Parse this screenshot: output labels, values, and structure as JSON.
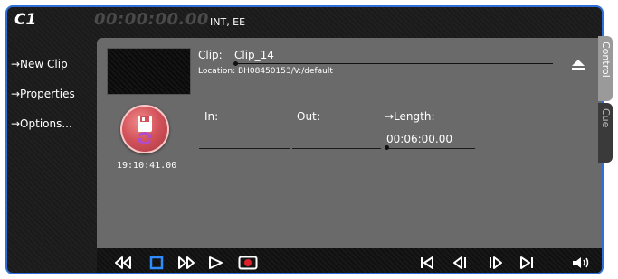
{
  "header": {
    "channel": "C1",
    "timecode": "00:00:00.00",
    "mode": "INT, EE"
  },
  "sidebar": {
    "items": [
      {
        "label": "→New Clip"
      },
      {
        "label": "→Properties"
      },
      {
        "label": "→Options..."
      }
    ]
  },
  "clip": {
    "label": "Clip:",
    "name": "Clip_14",
    "location": "Location: BH08450153/V:/default"
  },
  "record": {
    "time": "19:10:41.00"
  },
  "fields": {
    "in_label": "In:",
    "out_label": "Out:",
    "length_label": "→Length:",
    "length_value": "00:06:00.00"
  },
  "tabs": {
    "control": "Control",
    "cue": "Cue"
  },
  "transport": {
    "buttons": [
      "rewind-icon",
      "stop-icon",
      "fast-forward-icon",
      "play-icon",
      "record-icon",
      "go-to-start-icon",
      "step-back-icon",
      "step-forward-icon",
      "go-to-end-icon",
      "volume-icon"
    ]
  },
  "colors": {
    "accent_border": "#2f6fd8",
    "record_button": "#d2525a",
    "stop_button": "#2f8cff",
    "panel": "#6a6a6a"
  }
}
